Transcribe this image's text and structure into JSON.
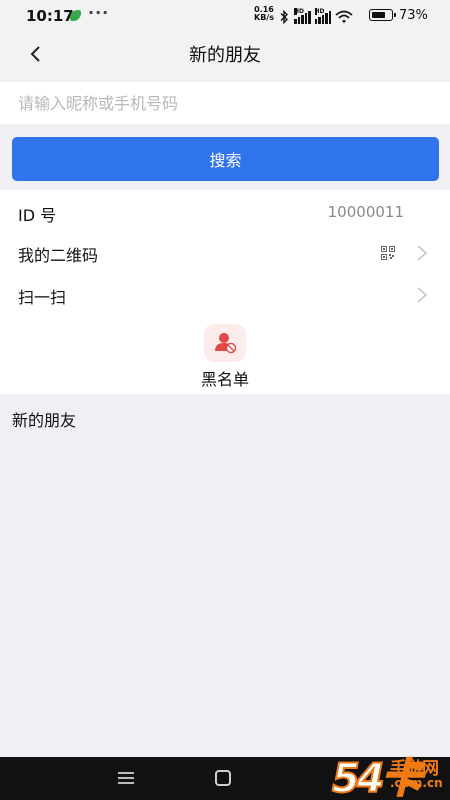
{
  "status_bar": {
    "time": "10:17",
    "dots": "···",
    "speed_value": "0.16",
    "speed_unit": "KB/s",
    "hd_label": "HD",
    "battery_percent": 73,
    "battery_text": "73%"
  },
  "header": {
    "title": "新的朋友",
    "back_icon": "chevron-left-icon"
  },
  "search": {
    "placeholder": "请输入昵称或手机号码",
    "value": "",
    "button_label": "搜索"
  },
  "menu": {
    "id_label": "ID 号",
    "id_value": "10000011",
    "qrcode_label": "我的二维码",
    "scan_label": "扫一扫"
  },
  "blacklist": {
    "label": "黑名单",
    "icon": "user-block-icon"
  },
  "section": {
    "title": "新的朋友"
  },
  "nav": {
    "menu_icon": "menu-icon",
    "home_icon": "home-icon"
  },
  "watermark": {
    "number": "54",
    "glyph": "卡",
    "text": "手游网",
    "url": ".com.cn"
  },
  "colors": {
    "accent": "#2f74eb",
    "background": "#efeff4",
    "danger": "#e04848",
    "watermark": "#f07a14"
  }
}
